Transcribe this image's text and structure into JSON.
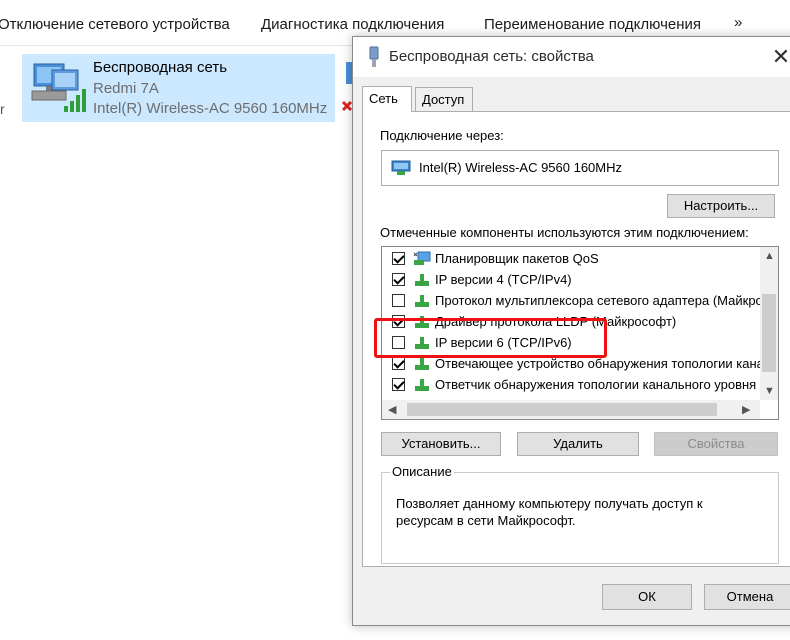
{
  "toolbar": {
    "items": [
      "Отключение сетевого устройства",
      "Диагностика подключения",
      "Переименование подключения"
    ],
    "more": "»"
  },
  "adapter": {
    "name": "Беспроводная сеть",
    "ssid": "Redmi 7A",
    "device": "Intel(R) Wireless-AC 9560 160MHz"
  },
  "left_stub": "r",
  "dialog": {
    "title": "Беспроводная сеть: свойства",
    "close": "✕",
    "tabs": [
      "Сеть",
      "Доступ"
    ],
    "connect_via_label": "Подключение через:",
    "adapter_name": "Intel(R) Wireless-AC 9560 160MHz",
    "configure_button": "Настроить...",
    "components_label": "Отмеченные компоненты используются этим подключением:",
    "components": [
      {
        "label": "Планировщик пакетов QoS",
        "checked": true,
        "icon": "qos-icon"
      },
      {
        "label": "IP версии 4 (TCP/IPv4)",
        "checked": true,
        "icon": "protocol-icon"
      },
      {
        "label": "Протокол мультиплексора сетевого адаптера (Майкрософт)",
        "checked": false,
        "icon": "protocol-icon"
      },
      {
        "label": "Драйвер протокола LLDP (Майкрософт)",
        "checked": true,
        "icon": "protocol-icon"
      },
      {
        "label": "IP версии 6 (TCP/IPv6)",
        "checked": false,
        "icon": "protocol-icon"
      },
      {
        "label": "Отвечающее устройство обнаружения топологии канального уровня",
        "checked": true,
        "icon": "protocol-icon"
      },
      {
        "label": "Ответчик обнаружения топологии канального уровня",
        "checked": true,
        "icon": "protocol-icon"
      }
    ],
    "install_button": "Установить...",
    "remove_button": "Удалить",
    "properties_button": "Свойства",
    "description_legend": "Описание",
    "description_text": "Позволяет данному компьютеру получать доступ к ресурсам в сети Майкрософт.",
    "ok_button": "ОК",
    "cancel_button": "Отмена"
  },
  "colors": {
    "selection": "#cce8ff",
    "highlight": "#ee1111",
    "dialog_bg": "#f0f0f0"
  }
}
